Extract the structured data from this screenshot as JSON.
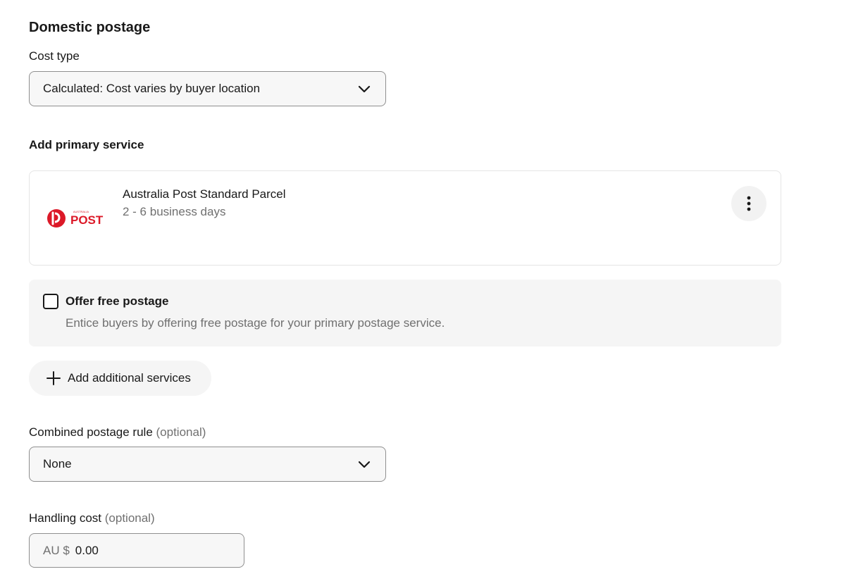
{
  "domestic": {
    "title": "Domestic postage",
    "cost_type_label": "Cost type",
    "cost_type_value": "Calculated: Cost varies by buyer location"
  },
  "primary_service": {
    "heading": "Add primary service",
    "carrier_logo": "australia-post-logo",
    "name": "Australia Post Standard Parcel",
    "delivery_time": "2 - 6 business days",
    "menu_icon": "more-vertical-icon"
  },
  "free_postage": {
    "checked": false,
    "label": "Offer free postage",
    "description": "Entice buyers by offering free postage for your primary postage service."
  },
  "add_services": {
    "icon": "plus-icon",
    "label": "Add additional services"
  },
  "combined_rule": {
    "label": "Combined postage rule",
    "optional": "(optional)",
    "value": "None"
  },
  "handling": {
    "label": "Handling cost",
    "optional": "(optional)",
    "prefix": "AU $",
    "value": "0.00"
  },
  "colors": {
    "text": "#191919",
    "muted": "#707070",
    "border": "#8f8f8f",
    "brand_red": "#dc1928"
  }
}
